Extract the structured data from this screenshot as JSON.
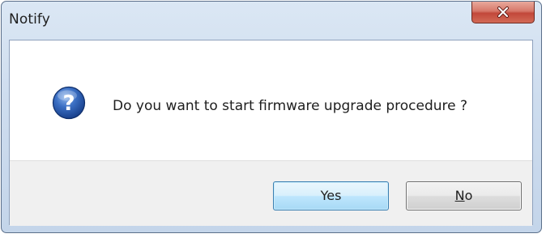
{
  "window": {
    "title": "Notify"
  },
  "message": {
    "text": "Do you want to start firmware upgrade procedure ?",
    "icon": "question-icon"
  },
  "buttons": {
    "yes_label": "Yes",
    "no_mnemonic": "N",
    "no_rest": "o"
  },
  "colors": {
    "close_button": "#c2483a",
    "question_icon": "#1f4fa0",
    "frame": "#cddcee"
  }
}
